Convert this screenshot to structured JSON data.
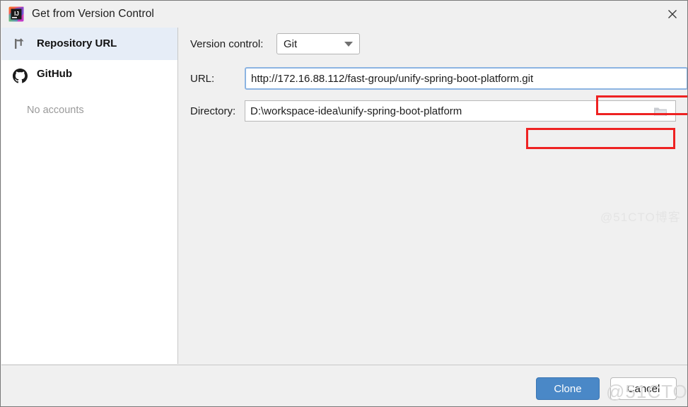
{
  "window": {
    "title": "Get from Version Control",
    "app_icon": "intellij-idea-icon",
    "close_label": "×"
  },
  "sidebar": {
    "items": [
      {
        "label": "Repository URL",
        "icon": "git-branch-icon",
        "selected": true,
        "sublabel": ""
      },
      {
        "label": "GitHub",
        "icon": "github-icon",
        "selected": false,
        "sublabel": "No accounts"
      }
    ]
  },
  "form": {
    "version_control": {
      "label": "Version control:",
      "value": "Git",
      "options": [
        "Git"
      ],
      "arrow_icon": "chevron-down-icon"
    },
    "url": {
      "label": "URL:",
      "value": "http://172.16.88.112/fast-group/unify-spring-boot-platform.git",
      "focused": true
    },
    "directory": {
      "label": "Directory:",
      "value": "D:\\workspace-idea\\unify-spring-boot-platform",
      "browse_icon": "folder-icon"
    }
  },
  "annotations": {
    "color": "#ee2222",
    "url_highlight": "unify-spring-boot-platform.git",
    "directory_highlight": "\\unify-spring-boot-platform"
  },
  "footer": {
    "clone_label": "Clone",
    "cancel_label": "Cancel",
    "clone_color": "#4a88c7"
  },
  "watermark": {
    "text": "@51CTO博客"
  }
}
